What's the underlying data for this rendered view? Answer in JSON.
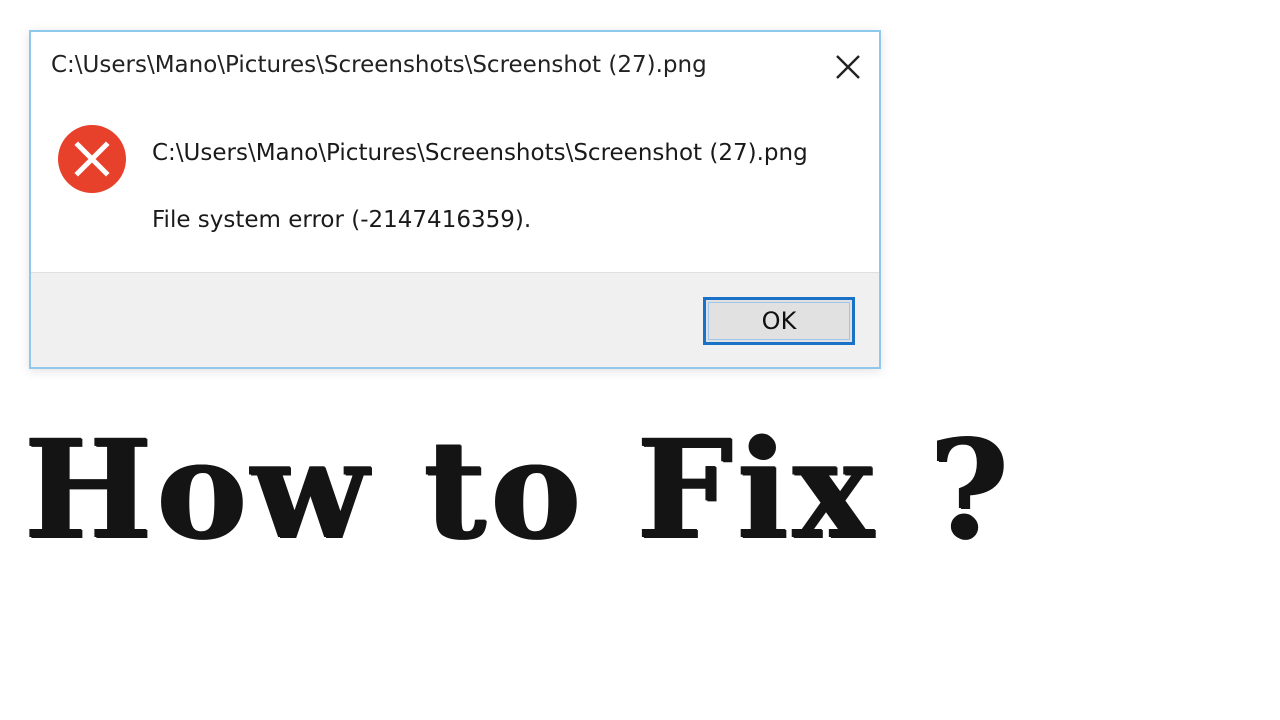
{
  "dialog": {
    "title": "C:\\Users\\Mano\\Pictures\\Screenshots\\Screenshot (27).png",
    "close_icon": "close-icon",
    "error_icon": "error-icon",
    "message_path": "C:\\Users\\Mano\\Pictures\\Screenshots\\Screenshot (27).png",
    "message_error": "File system error (-2147416359).",
    "ok_label": "OK",
    "colors": {
      "border": "#8ec8ea",
      "error_red": "#e8412b",
      "button_focus": "#1a72c8",
      "footer_bg": "#f0f0f0"
    }
  },
  "headline": {
    "text": "How to Fix ?"
  }
}
